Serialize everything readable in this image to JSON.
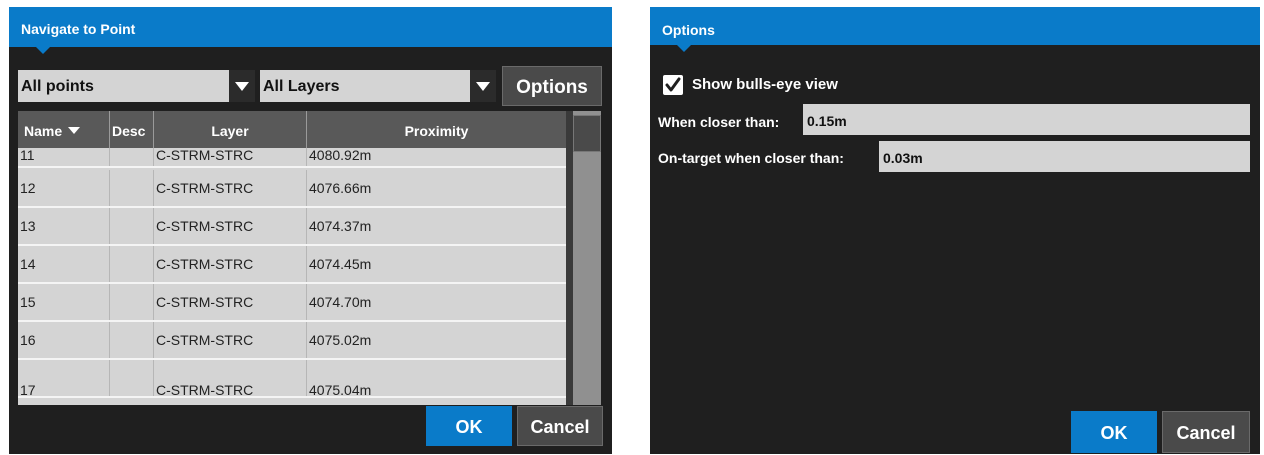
{
  "navigate": {
    "title": "Navigate to Point",
    "point_filter": "All points",
    "layer_filter": "All Layers",
    "options_label": "Options",
    "columns": [
      "Name",
      "Desc",
      "Layer",
      "Proximity"
    ],
    "rows": [
      {
        "name": "11",
        "desc": "",
        "layer": "C-STRM-STRC",
        "proximity": "4080.92m"
      },
      {
        "name": "12",
        "desc": "",
        "layer": "C-STRM-STRC",
        "proximity": "4076.66m"
      },
      {
        "name": "13",
        "desc": "",
        "layer": "C-STRM-STRC",
        "proximity": "4074.37m"
      },
      {
        "name": "14",
        "desc": "",
        "layer": "C-STRM-STRC",
        "proximity": "4074.45m"
      },
      {
        "name": "15",
        "desc": "",
        "layer": "C-STRM-STRC",
        "proximity": "4074.70m"
      },
      {
        "name": "16",
        "desc": "",
        "layer": "C-STRM-STRC",
        "proximity": "4075.02m"
      },
      {
        "name": "17",
        "desc": "",
        "layer": "C-STRM-STRC",
        "proximity": "4075.04m"
      }
    ],
    "ok_label": "OK",
    "cancel_label": "Cancel"
  },
  "options": {
    "title": "Options",
    "show_bullseye_label": "Show bulls-eye view",
    "show_bullseye_checked": true,
    "closer_label": "When closer than:",
    "closer_value": "0.15m",
    "ontarget_label": "On-target when closer than:",
    "ontarget_value": "0.03m",
    "ok_label": "OK",
    "cancel_label": "Cancel"
  },
  "colors": {
    "accent": "#0a7bc9",
    "dialog_bg": "#1f1f1f",
    "field_bg": "#d4d4d4"
  }
}
